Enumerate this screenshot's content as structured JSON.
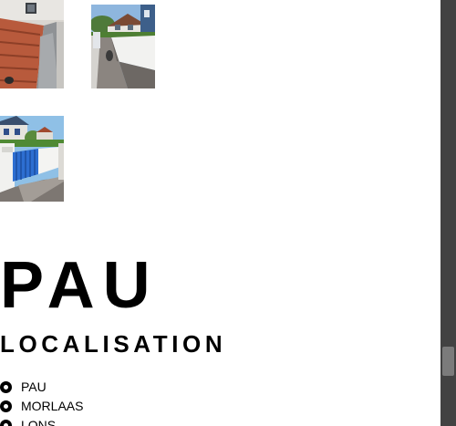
{
  "gallery": {
    "photos": [
      {
        "icon": "roof-photo"
      },
      {
        "icon": "street-house-photo"
      },
      {
        "icon": "blue-gate-photo"
      }
    ]
  },
  "section": {
    "city_title": "PAU",
    "localisation_title": "LOCALISATION",
    "locations": [
      "PAU",
      "MORLAAS",
      "LONS"
    ]
  },
  "colors": {
    "text": "#000000",
    "background": "#ffffff",
    "scrollbar_track": "#424242",
    "scrollbar_thumb": "#7b7b7b"
  }
}
